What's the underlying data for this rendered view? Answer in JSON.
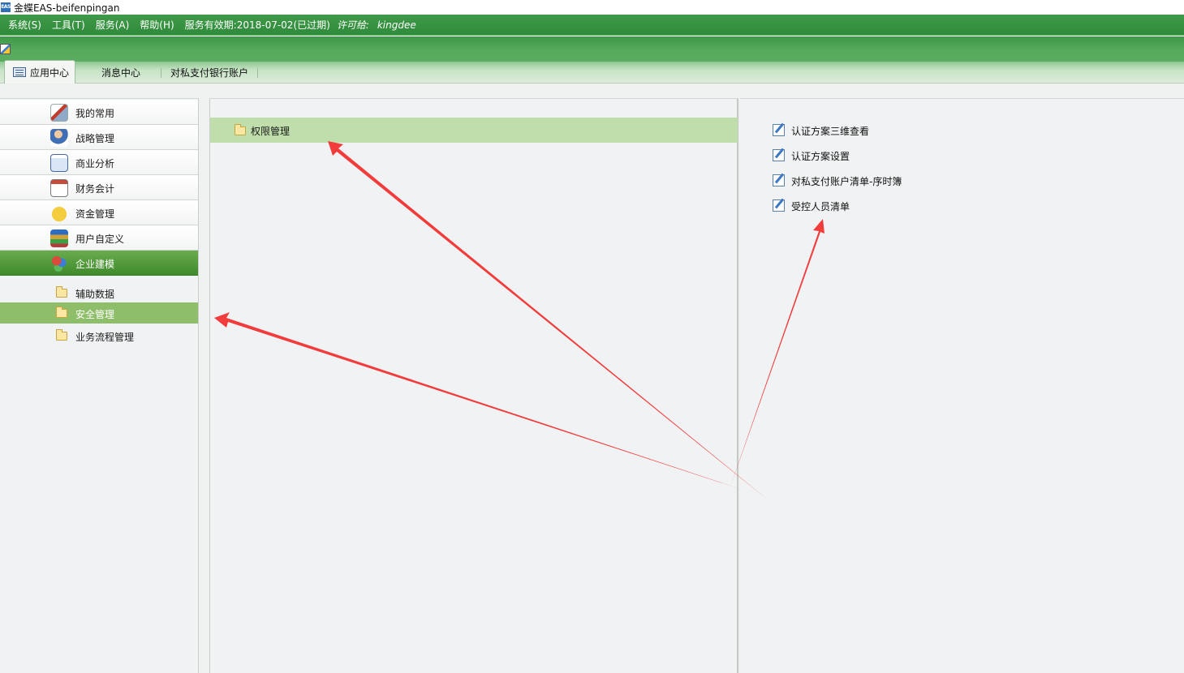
{
  "window": {
    "logo_text": "EAS",
    "title": "金蝶EAS-beifenpingan"
  },
  "menubar": {
    "items": [
      "系统(S)",
      "工具(T)",
      "服务(A)",
      "帮助(H)"
    ],
    "service_info": "服务有效期:2018-07-02(已过期)",
    "license_label": "许可给:",
    "license_value": "kingdee"
  },
  "tabs": [
    {
      "label": "应用中心",
      "active": true
    },
    {
      "label": "消息中心",
      "active": false
    },
    {
      "label": "对私支付银行账户",
      "active": false
    }
  ],
  "sidebar": {
    "items": [
      {
        "label": "我的常用",
        "icon": "favorites-icon"
      },
      {
        "label": "战略管理",
        "icon": "strategy-icon"
      },
      {
        "label": "商业分析",
        "icon": "business-analysis-icon"
      },
      {
        "label": "财务会计",
        "icon": "finance-icon"
      },
      {
        "label": "资金管理",
        "icon": "fund-icon"
      },
      {
        "label": "用户自定义",
        "icon": "custom-icon"
      },
      {
        "label": "企业建模",
        "icon": "modeling-icon",
        "active": true
      }
    ],
    "subitems": [
      {
        "label": "辅助数据"
      },
      {
        "label": "安全管理",
        "selected": true
      },
      {
        "label": "业务流程管理"
      }
    ]
  },
  "middle": {
    "folders": [
      {
        "label": "权限管理",
        "selected": true
      }
    ]
  },
  "functions": [
    {
      "label": "认证方案三维查看"
    },
    {
      "label": "认证方案设置"
    },
    {
      "label": "对私支付账户清单-序时簿"
    },
    {
      "label": "受控人员清单"
    }
  ],
  "colors": {
    "menubar_green": "#2f8a3b",
    "active_nav_green": "#4f9a3a",
    "selected_item_green": "#8fbe6b",
    "highlight_row_green": "#bfdeab",
    "annotation_arrow_red": "#f23b3b"
  }
}
